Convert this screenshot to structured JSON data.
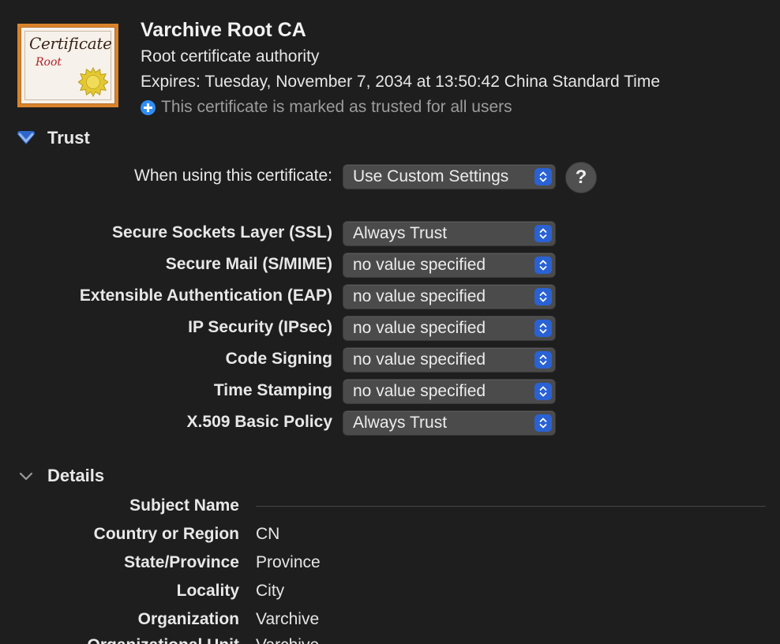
{
  "header": {
    "title": "Varchive Root CA",
    "subtitle": "Root certificate authority",
    "expires": "Expires: Tuesday, November 7, 2034 at 13:50:42 China Standard Time",
    "trusted_status": "This certificate is marked as trusted for all users",
    "thumbnail": {
      "word": "Certificate",
      "sub": "Root"
    }
  },
  "trust": {
    "section_title": "Trust",
    "when_using_label": "When using this certificate:",
    "when_using_value": "Use Custom Settings",
    "help_label": "?",
    "rows": [
      {
        "label": "Secure Sockets Layer (SSL)",
        "value": "Always Trust"
      },
      {
        "label": "Secure Mail (S/MIME)",
        "value": "no value specified"
      },
      {
        "label": "Extensible Authentication (EAP)",
        "value": "no value specified"
      },
      {
        "label": "IP Security (IPsec)",
        "value": "no value specified"
      },
      {
        "label": "Code Signing",
        "value": "no value specified"
      },
      {
        "label": "Time Stamping",
        "value": "no value specified"
      },
      {
        "label": "X.509 Basic Policy",
        "value": "Always Trust"
      }
    ]
  },
  "details": {
    "section_title": "Details",
    "subject_name_label": "Subject Name",
    "fields": [
      {
        "label": "Country or Region",
        "value": "CN"
      },
      {
        "label": "State/Province",
        "value": "Province"
      },
      {
        "label": "Locality",
        "value": "City"
      },
      {
        "label": "Organization",
        "value": "Varchive"
      },
      {
        "label": "Organizational Unit",
        "value": "Varchive"
      }
    ]
  },
  "colors": {
    "background": "#1e1e1e",
    "popup": "#4b4b4b",
    "accent": "#2a62d4",
    "trusted_icon": "#2f8df5",
    "thumbnail_frame": "#d9832b"
  },
  "icons": {
    "trusted": "plus-circle-icon",
    "trust_disclosure": "chevron-down-icon",
    "details_disclosure": "chevron-down-icon",
    "popup_stepper": "up-down-chevrons-icon",
    "seal": "gold-seal-icon"
  }
}
